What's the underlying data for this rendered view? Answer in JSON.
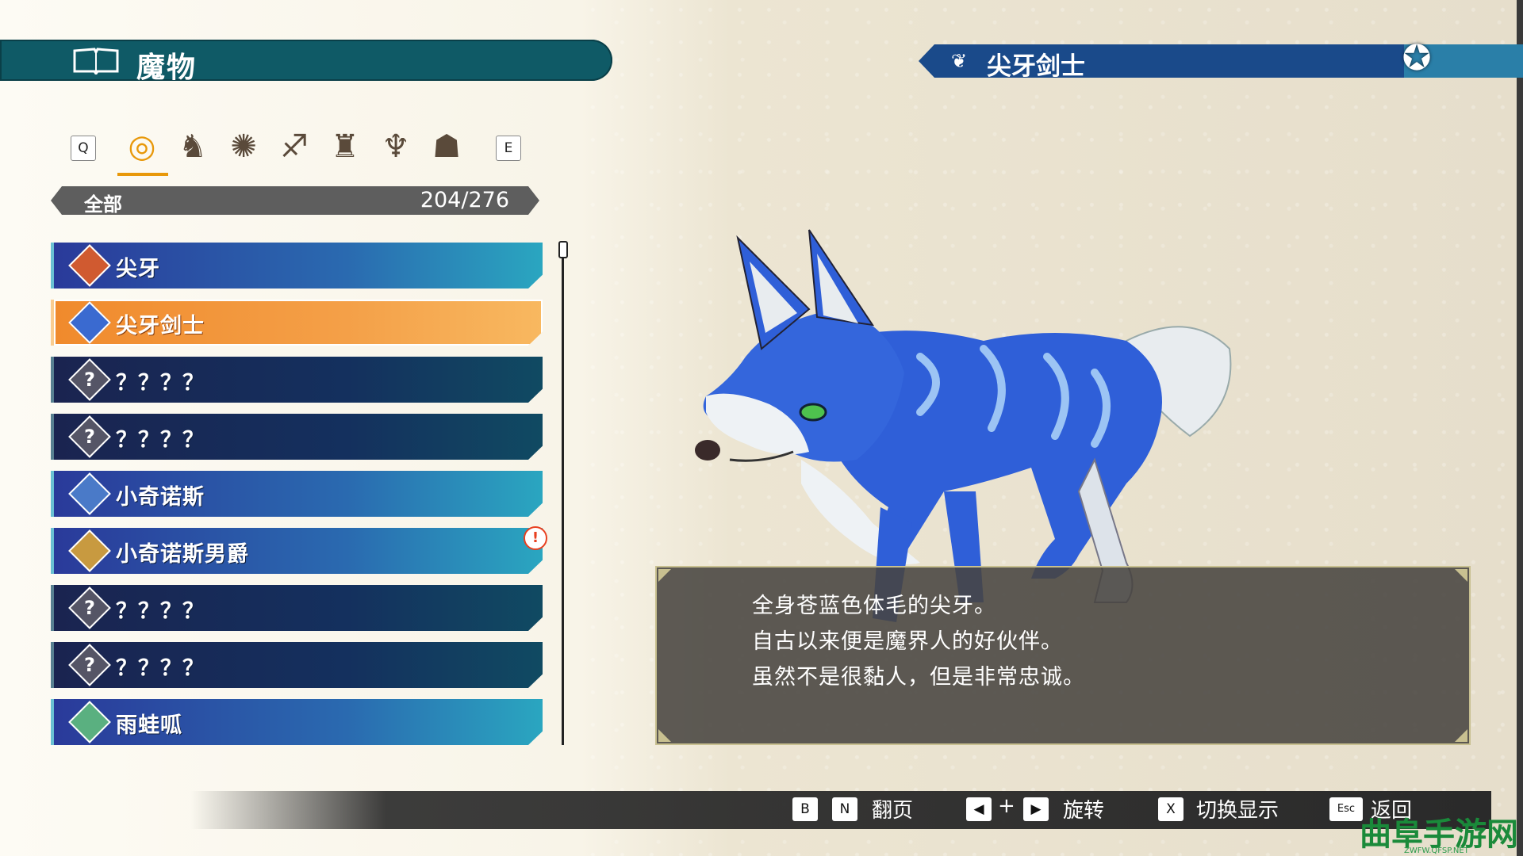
{
  "header": {
    "title": "魔物",
    "book_icon": "book-icon"
  },
  "detail_header": {
    "name": "尖牙剑士",
    "type_icon": "beast-type-icon",
    "emblem_icon": "dice-emblem-icon"
  },
  "category_bar": {
    "prev_key": "Q",
    "next_key": "E",
    "categories": [
      {
        "icon": "all-ring-icon",
        "glyph": "◎",
        "active": true
      },
      {
        "icon": "beast-icon",
        "glyph": "🐾"
      },
      {
        "icon": "insect-icon",
        "glyph": "✺"
      },
      {
        "icon": "dragon-icon",
        "glyph": "🐉"
      },
      {
        "icon": "object-icon",
        "glyph": "⍾"
      },
      {
        "icon": "spirit-icon",
        "glyph": "ℨ"
      },
      {
        "icon": "giant-icon",
        "glyph": "☗"
      }
    ]
  },
  "filter": {
    "label": "全部",
    "count": "204/276"
  },
  "monsters": [
    {
      "name": "尖牙",
      "state": "known"
    },
    {
      "name": "尖牙剑士",
      "state": "selected"
    },
    {
      "name": "？？？？",
      "state": "unknown"
    },
    {
      "name": "？？？？",
      "state": "unknown"
    },
    {
      "name": "小奇诺斯",
      "state": "known"
    },
    {
      "name": "小奇诺斯男爵",
      "state": "known"
    },
    {
      "name": "？？？？",
      "state": "unknown"
    },
    {
      "name": "？？？？",
      "state": "unknown"
    },
    {
      "name": "雨蛙呱",
      "state": "known"
    }
  ],
  "alert_badge": "!",
  "description": {
    "lines": [
      "全身苍蓝色体毛的尖牙。",
      "自古以来便是魔界人的好伙伴。",
      "虽然不是很黏人，但是非常忠诚。"
    ]
  },
  "controls": {
    "page_keys": [
      "B",
      "N"
    ],
    "page_label": "翻页",
    "rotate_plus": "+",
    "rotate_label": "旋转",
    "toggle_key": "X",
    "toggle_label": "切换显示",
    "back_key": "Esc",
    "back_label": "返回"
  },
  "watermark": {
    "text": "曲阜手游网",
    "sub": "ZWFW.QFSP.NET"
  },
  "colors": {
    "header_teal": "#0f5a66",
    "selected_orange": "#f4a048",
    "known_blue": "#2a6ab0",
    "unknown_navy": "#14305e",
    "accent_orange": "#e8980a"
  }
}
